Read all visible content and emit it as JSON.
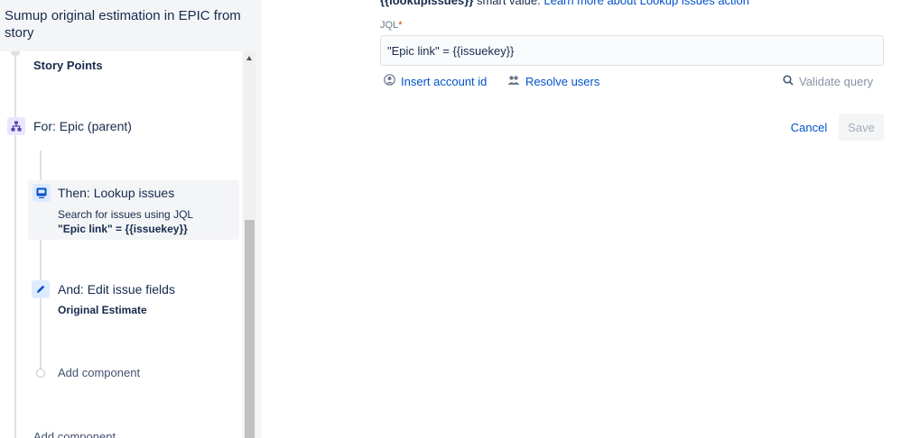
{
  "rule": {
    "title": "Sumup original estimation in EPIC from story"
  },
  "flow": {
    "prev_field": "Story Points",
    "branch": {
      "label": "For: Epic (parent)",
      "icon": "branch-icon"
    },
    "lookup": {
      "title": "Then: Lookup issues",
      "description": "Search for issues using JQL",
      "jql": "\"Epic link\" = {{issuekey}}",
      "icon": "lookup-icon"
    },
    "edit": {
      "title": "And: Edit issue fields",
      "field": "Original Estimate",
      "icon": "pencil-icon"
    },
    "add_inner": "Add component",
    "add_outer": "Add component"
  },
  "config": {
    "smart_value_prefix": "{{lookupIssues}}",
    "smart_value_text": " smart value. ",
    "learn_more_link": "Learn more about Lookup issues action",
    "jql_label": "JQL",
    "jql_required_mark": "*",
    "jql_value": "\"Epic link\" = {{issuekey}}",
    "insert_account_id": "Insert account id",
    "resolve_users": "Resolve users",
    "validate_query": "Validate query",
    "cancel": "Cancel",
    "save": "Save"
  },
  "colors": {
    "link": "#0052cc",
    "text": "#172b4d",
    "panel_bg": "#f4f5f7",
    "branch_icon_bg": "#eae6ff",
    "action_icon_bg": "#deebff"
  }
}
